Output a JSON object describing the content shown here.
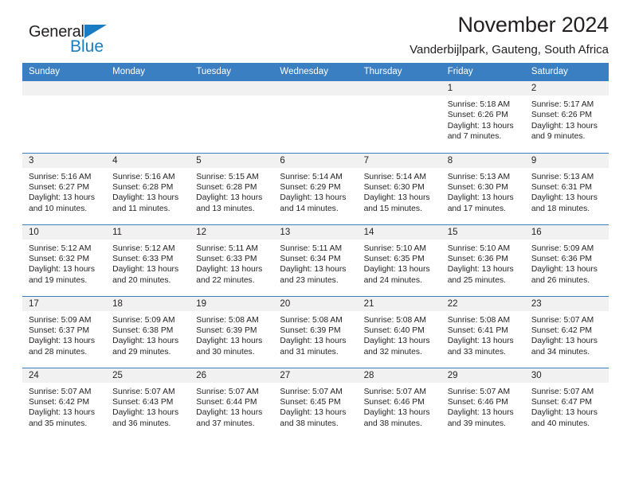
{
  "brand": {
    "name_dark": "General",
    "name_blue": "Blue",
    "accent_color": "#1a7dc4"
  },
  "header": {
    "month_title": "November 2024",
    "location": "Vanderbijlpark, Gauteng, South Africa"
  },
  "calendar": {
    "header_color": "#3a7fc1",
    "daynum_band_color": "#f1f1f1",
    "weekday_headers": [
      "Sunday",
      "Monday",
      "Tuesday",
      "Wednesday",
      "Thursday",
      "Friday",
      "Saturday"
    ],
    "weeks": [
      [
        {
          "day": "",
          "info": ""
        },
        {
          "day": "",
          "info": ""
        },
        {
          "day": "",
          "info": ""
        },
        {
          "day": "",
          "info": ""
        },
        {
          "day": "",
          "info": ""
        },
        {
          "day": "1",
          "info": "Sunrise: 5:18 AM\nSunset: 6:26 PM\nDaylight: 13 hours\nand 7 minutes."
        },
        {
          "day": "2",
          "info": "Sunrise: 5:17 AM\nSunset: 6:26 PM\nDaylight: 13 hours\nand 9 minutes."
        }
      ],
      [
        {
          "day": "3",
          "info": "Sunrise: 5:16 AM\nSunset: 6:27 PM\nDaylight: 13 hours\nand 10 minutes."
        },
        {
          "day": "4",
          "info": "Sunrise: 5:16 AM\nSunset: 6:28 PM\nDaylight: 13 hours\nand 11 minutes."
        },
        {
          "day": "5",
          "info": "Sunrise: 5:15 AM\nSunset: 6:28 PM\nDaylight: 13 hours\nand 13 minutes."
        },
        {
          "day": "6",
          "info": "Sunrise: 5:14 AM\nSunset: 6:29 PM\nDaylight: 13 hours\nand 14 minutes."
        },
        {
          "day": "7",
          "info": "Sunrise: 5:14 AM\nSunset: 6:30 PM\nDaylight: 13 hours\nand 15 minutes."
        },
        {
          "day": "8",
          "info": "Sunrise: 5:13 AM\nSunset: 6:30 PM\nDaylight: 13 hours\nand 17 minutes."
        },
        {
          "day": "9",
          "info": "Sunrise: 5:13 AM\nSunset: 6:31 PM\nDaylight: 13 hours\nand 18 minutes."
        }
      ],
      [
        {
          "day": "10",
          "info": "Sunrise: 5:12 AM\nSunset: 6:32 PM\nDaylight: 13 hours\nand 19 minutes."
        },
        {
          "day": "11",
          "info": "Sunrise: 5:12 AM\nSunset: 6:33 PM\nDaylight: 13 hours\nand 20 minutes."
        },
        {
          "day": "12",
          "info": "Sunrise: 5:11 AM\nSunset: 6:33 PM\nDaylight: 13 hours\nand 22 minutes."
        },
        {
          "day": "13",
          "info": "Sunrise: 5:11 AM\nSunset: 6:34 PM\nDaylight: 13 hours\nand 23 minutes."
        },
        {
          "day": "14",
          "info": "Sunrise: 5:10 AM\nSunset: 6:35 PM\nDaylight: 13 hours\nand 24 minutes."
        },
        {
          "day": "15",
          "info": "Sunrise: 5:10 AM\nSunset: 6:36 PM\nDaylight: 13 hours\nand 25 minutes."
        },
        {
          "day": "16",
          "info": "Sunrise: 5:09 AM\nSunset: 6:36 PM\nDaylight: 13 hours\nand 26 minutes."
        }
      ],
      [
        {
          "day": "17",
          "info": "Sunrise: 5:09 AM\nSunset: 6:37 PM\nDaylight: 13 hours\nand 28 minutes."
        },
        {
          "day": "18",
          "info": "Sunrise: 5:09 AM\nSunset: 6:38 PM\nDaylight: 13 hours\nand 29 minutes."
        },
        {
          "day": "19",
          "info": "Sunrise: 5:08 AM\nSunset: 6:39 PM\nDaylight: 13 hours\nand 30 minutes."
        },
        {
          "day": "20",
          "info": "Sunrise: 5:08 AM\nSunset: 6:39 PM\nDaylight: 13 hours\nand 31 minutes."
        },
        {
          "day": "21",
          "info": "Sunrise: 5:08 AM\nSunset: 6:40 PM\nDaylight: 13 hours\nand 32 minutes."
        },
        {
          "day": "22",
          "info": "Sunrise: 5:08 AM\nSunset: 6:41 PM\nDaylight: 13 hours\nand 33 minutes."
        },
        {
          "day": "23",
          "info": "Sunrise: 5:07 AM\nSunset: 6:42 PM\nDaylight: 13 hours\nand 34 minutes."
        }
      ],
      [
        {
          "day": "24",
          "info": "Sunrise: 5:07 AM\nSunset: 6:42 PM\nDaylight: 13 hours\nand 35 minutes."
        },
        {
          "day": "25",
          "info": "Sunrise: 5:07 AM\nSunset: 6:43 PM\nDaylight: 13 hours\nand 36 minutes."
        },
        {
          "day": "26",
          "info": "Sunrise: 5:07 AM\nSunset: 6:44 PM\nDaylight: 13 hours\nand 37 minutes."
        },
        {
          "day": "27",
          "info": "Sunrise: 5:07 AM\nSunset: 6:45 PM\nDaylight: 13 hours\nand 38 minutes."
        },
        {
          "day": "28",
          "info": "Sunrise: 5:07 AM\nSunset: 6:46 PM\nDaylight: 13 hours\nand 38 minutes."
        },
        {
          "day": "29",
          "info": "Sunrise: 5:07 AM\nSunset: 6:46 PM\nDaylight: 13 hours\nand 39 minutes."
        },
        {
          "day": "30",
          "info": "Sunrise: 5:07 AM\nSunset: 6:47 PM\nDaylight: 13 hours\nand 40 minutes."
        }
      ]
    ]
  }
}
